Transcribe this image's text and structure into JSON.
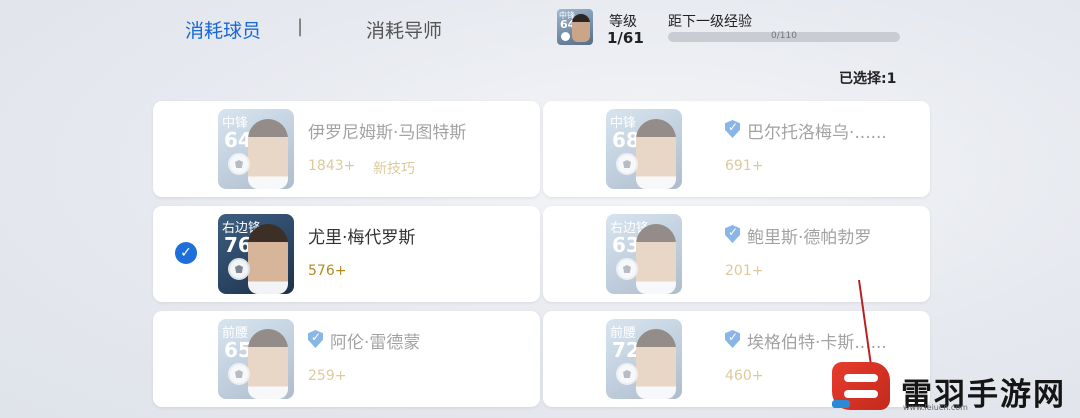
{
  "tabs": [
    {
      "label": "消耗球员",
      "active": true
    },
    {
      "label": "消耗导师",
      "active": false
    }
  ],
  "tab_separator": "|",
  "level": {
    "card": {
      "position": "中锋",
      "rating": "64"
    },
    "label": "等级",
    "value": "1/61",
    "exp_label": "距下一级经验",
    "exp_text": "0/110",
    "exp_progress": 0
  },
  "selected_count": "已选择:1",
  "players": [
    {
      "position": "中锋",
      "rating": "64",
      "name": "伊罗尼姆斯·马图特斯",
      "value": "1843+",
      "skill": "新技巧",
      "verified": false,
      "selected": false,
      "enabled": false
    },
    {
      "position": "中锋",
      "rating": "68",
      "name": "巴尔托洛梅乌·......",
      "value": "691+",
      "skill": "",
      "verified": true,
      "selected": false,
      "enabled": false
    },
    {
      "position": "右边锋",
      "rating": "76",
      "name": "尤里·梅代罗斯",
      "value": "576+",
      "skill": "",
      "verified": false,
      "selected": true,
      "enabled": true
    },
    {
      "position": "右边锋",
      "rating": "63",
      "name": "鲍里斯·德帕勃罗",
      "value": "201+",
      "skill": "",
      "verified": true,
      "selected": false,
      "enabled": false
    },
    {
      "position": "前腰",
      "rating": "65",
      "name": "阿伦·雷德蒙",
      "value": "259+",
      "skill": "",
      "verified": true,
      "selected": false,
      "enabled": false
    },
    {
      "position": "前腰",
      "rating": "72",
      "name": "埃格伯特·卡斯......",
      "value": "460+",
      "skill": "",
      "verified": true,
      "selected": false,
      "enabled": false
    }
  ],
  "check_icon": "✓",
  "watermark": {
    "text": "雷羽手游网",
    "url": "www.leiucn.com"
  },
  "colors": {
    "accent": "#1e6fd9",
    "value": "#b48a25",
    "verified": "#8ab6e7"
  }
}
